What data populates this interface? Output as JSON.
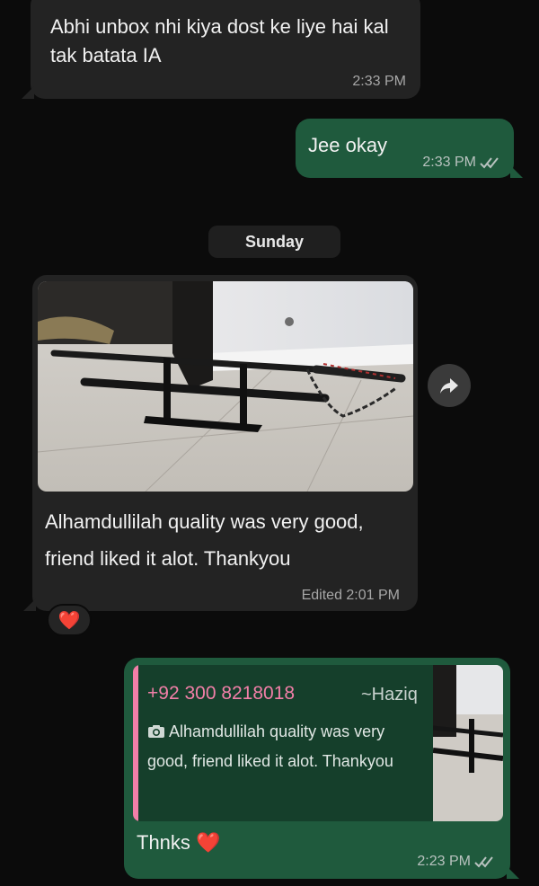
{
  "messages": {
    "m1": {
      "text": "Abhi unbox nhi kiya dost ke liye hai kal tak batata IA",
      "time": "2:33 PM"
    },
    "m2": {
      "text": "Jee okay",
      "time": "2:33 PM"
    },
    "date_separator": "Sunday",
    "m3": {
      "caption": "Alhamdullilah quality was very good, friend liked it alot. Thankyou",
      "time": "Edited 2:01 PM",
      "reaction": "❤️"
    },
    "m4": {
      "quote": {
        "sender": "+92 300 8218018",
        "sender_name": "~Haziq",
        "text": "Alhamdullilah quality was very good, friend liked it alot. Thankyou"
      },
      "text": "Thnks ❤️",
      "time": "2:23 PM"
    }
  },
  "icons": {
    "forward": "forward-arrow-icon",
    "camera": "camera-icon",
    "read_ticks": "double-check-icon"
  },
  "colors": {
    "incoming_bubble": "#232323",
    "outgoing_bubble": "#1f5a3d",
    "quote_accent": "#f27fa8",
    "background": "#0b0b0b"
  }
}
